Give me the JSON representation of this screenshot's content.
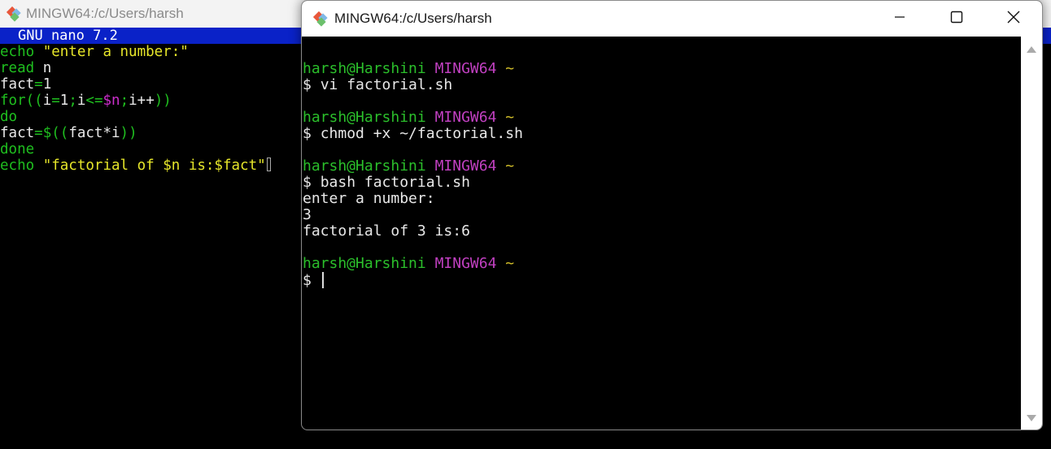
{
  "bg_window": {
    "title": "MINGW64:/c/Users/harsh",
    "nano_header": "GNU nano 7.2",
    "code_lines": [
      [
        {
          "t": "echo",
          "c": "c-green"
        },
        {
          "t": " ",
          "c": "c-white"
        },
        {
          "t": "\"enter a number:\"",
          "c": "c-yellow"
        }
      ],
      [
        {
          "t": "read",
          "c": "c-green"
        },
        {
          "t": " n",
          "c": "c-white"
        }
      ],
      [
        {
          "t": "fact",
          "c": "c-white"
        },
        {
          "t": "=",
          "c": "c-green"
        },
        {
          "t": "1",
          "c": "c-white"
        }
      ],
      [
        {
          "t": "for((",
          "c": "c-green"
        },
        {
          "t": "i",
          "c": "c-white"
        },
        {
          "t": "=",
          "c": "c-green"
        },
        {
          "t": "1",
          "c": "c-white"
        },
        {
          "t": ";",
          "c": "c-green"
        },
        {
          "t": "i",
          "c": "c-white"
        },
        {
          "t": "<=",
          "c": "c-green"
        },
        {
          "t": "$n",
          "c": "c-magenta"
        },
        {
          "t": ";",
          "c": "c-green"
        },
        {
          "t": "i++",
          "c": "c-white"
        },
        {
          "t": "))",
          "c": "c-green"
        }
      ],
      [
        {
          "t": "do",
          "c": "c-green"
        }
      ],
      [
        {
          "t": "fact",
          "c": "c-white"
        },
        {
          "t": "=",
          "c": "c-green"
        },
        {
          "t": "$((",
          "c": "c-green"
        },
        {
          "t": "fact*i",
          "c": "c-white"
        },
        {
          "t": "))",
          "c": "c-green"
        }
      ],
      [
        {
          "t": "done",
          "c": "c-green"
        }
      ],
      [
        {
          "t": "echo",
          "c": "c-green"
        },
        {
          "t": " ",
          "c": "c-white"
        },
        {
          "t": "\"factorial of $n is:$fact\"",
          "c": "c-yellow"
        }
      ]
    ]
  },
  "fg_window": {
    "title": "MINGW64:/c/Users/harsh",
    "controls": {
      "minimize": "minimize-icon",
      "maximize": "maximize-icon",
      "close": "close-icon"
    },
    "prompt": {
      "user": "harsh@Harshini",
      "host": "MINGW64",
      "dir": "~",
      "symbol": "$"
    },
    "blocks": [
      {
        "command": "vi factorial.sh",
        "output": []
      },
      {
        "command": "chmod +x ~/factorial.sh",
        "output": []
      },
      {
        "command": "bash factorial.sh",
        "output": [
          "enter a number:",
          "3",
          "factorial of 3 is:6"
        ]
      }
    ],
    "current_input": ""
  },
  "colors": {
    "nano_header_bg": "#0a22c8",
    "prompt_user": "#2bbf2b",
    "prompt_host": "#c040c0",
    "prompt_dir": "#d4c02a"
  }
}
